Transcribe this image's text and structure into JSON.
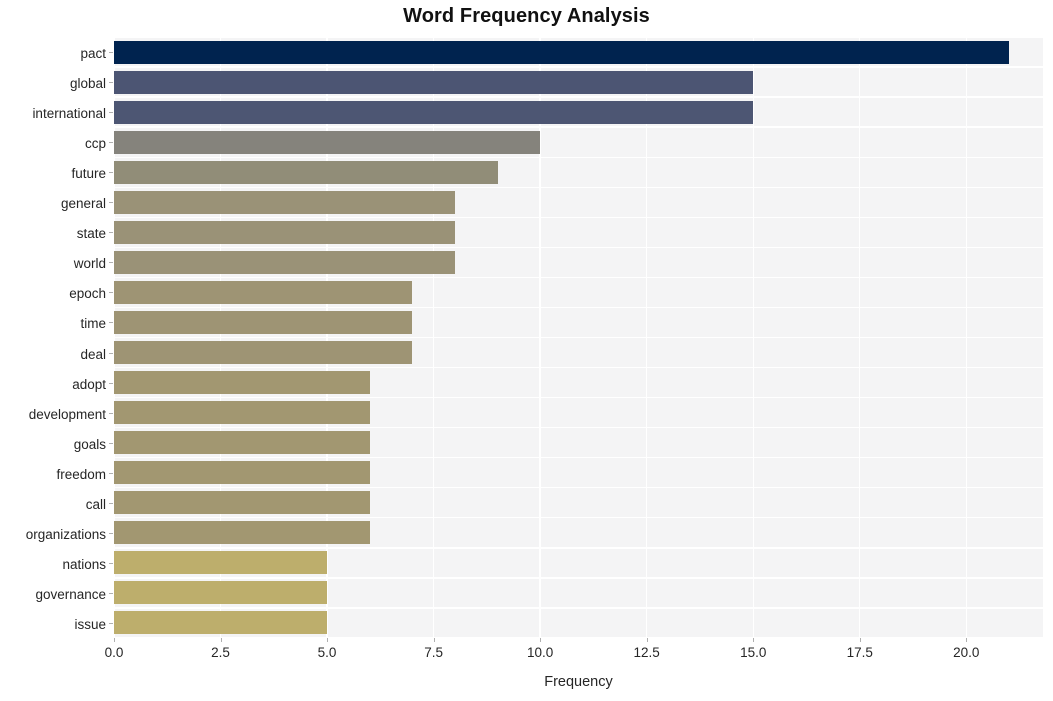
{
  "chart_data": {
    "type": "bar",
    "orientation": "horizontal",
    "title": "Word Frequency Analysis",
    "xlabel": "Frequency",
    "ylabel": "",
    "xlim": [
      0,
      21.8
    ],
    "xticks": [
      "0.0",
      "2.5",
      "5.0",
      "7.5",
      "10.0",
      "12.5",
      "15.0",
      "17.5",
      "20.0"
    ],
    "xtick_values": [
      0,
      2.5,
      5,
      7.5,
      10,
      12.5,
      15,
      17.5,
      20
    ],
    "grid": true,
    "legend": "none",
    "categories": [
      "pact",
      "global",
      "international",
      "ccp",
      "future",
      "general",
      "state",
      "world",
      "epoch",
      "time",
      "deal",
      "adopt",
      "development",
      "goals",
      "freedom",
      "call",
      "organizations",
      "nations",
      "governance",
      "issue"
    ],
    "values": [
      21,
      15,
      15,
      10,
      9,
      8,
      8,
      8,
      7,
      7,
      7,
      6,
      6,
      6,
      6,
      6,
      6,
      5,
      5,
      5
    ],
    "bar_colors": [
      "#00234f",
      "#4c5573",
      "#4d5673",
      "#85837c",
      "#918d78",
      "#9a9277",
      "#9a9277",
      "#9a9277",
      "#9e9474",
      "#9e9474",
      "#9e9474",
      "#a29771",
      "#a29771",
      "#a29771",
      "#a29771",
      "#a29771",
      "#a29771",
      "#bdae6c",
      "#bdae6c",
      "#bdae6c"
    ]
  },
  "style": {
    "plot_background": "#f4f4f5",
    "figure_background": "#ffffff",
    "gridline_color": "#ffffff",
    "text_color": "#262626",
    "title_color": "#111111"
  }
}
